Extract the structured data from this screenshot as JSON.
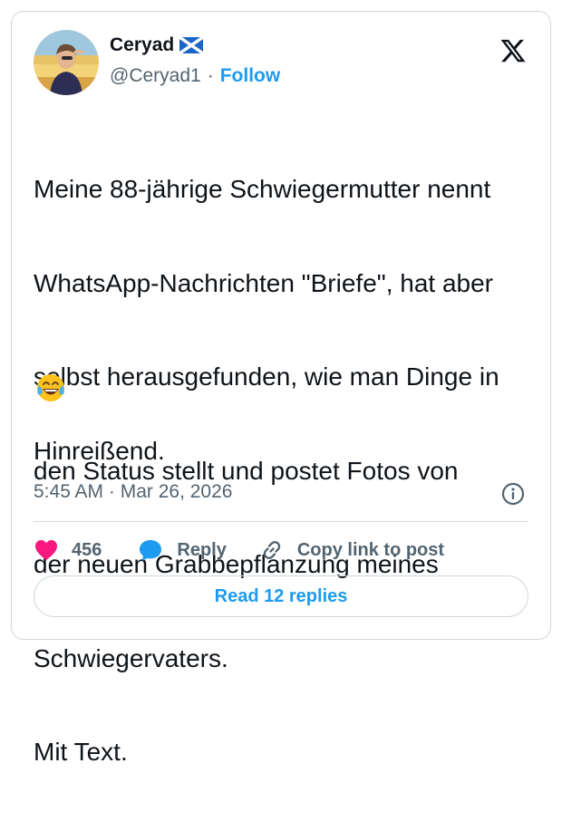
{
  "author": {
    "display_name": "Ceryad",
    "handle": "@Ceryad1",
    "separator": "·",
    "follow_label": "Follow",
    "flag_icon": "scotland-flag-icon"
  },
  "tweet": {
    "lines": [
      "Meine 88-jährige Schwiegermutter nennt",
      "WhatsApp-Nachrichten \"Briefe\", hat aber",
      "selbst herausgefunden, wie man Dinge in",
      "den Status stellt und postet Fotos von",
      "der neuen Grabbepflanzung meines",
      "Schwiegervaters.",
      "Mit Text."
    ],
    "emoji": "😂",
    "final_line": "Hinreißend.",
    "timestamp": "5:45 AM · Mar 26, 2026"
  },
  "actions": {
    "like_count": "456",
    "reply_label": "Reply",
    "copy_label": "Copy link to post",
    "read_replies_label": "Read 12 replies"
  },
  "colors": {
    "accent": "#1d9bf0",
    "like": "#f91880",
    "text": "#0f1419",
    "secondary": "#536471",
    "border": "#cfd9de"
  }
}
